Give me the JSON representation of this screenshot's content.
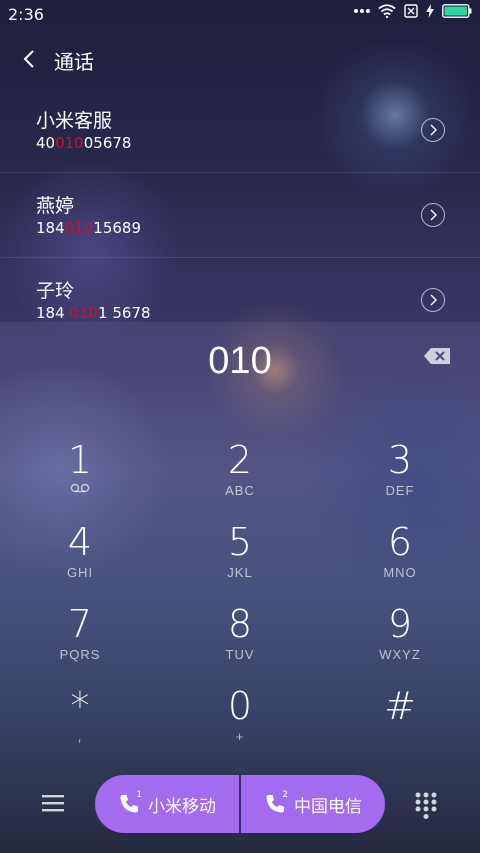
{
  "status_bar": {
    "time": "2:36",
    "icons": [
      "more-dots-icon",
      "wifi-icon",
      "no-sim-icon",
      "charging-icon",
      "battery-icon"
    ],
    "battery_color": "#2ed6a0"
  },
  "header": {
    "title": "通话"
  },
  "contacts": [
    {
      "name": "小米客服",
      "number_pre": "40",
      "number_match": "010",
      "number_post": "05678"
    },
    {
      "name": "燕婷",
      "number_pre": "184",
      "number_match": "010",
      "number_post": "15689"
    },
    {
      "name": "子玲",
      "number_pre": "184 ",
      "number_match": "010",
      "number_post": "1 5678"
    }
  ],
  "dialer": {
    "input": "010"
  },
  "keypad": [
    {
      "digit": "1",
      "letters": "",
      "sub_icon": "voicemail-icon"
    },
    {
      "digit": "2",
      "letters": "ABC"
    },
    {
      "digit": "3",
      "letters": "DEF"
    },
    {
      "digit": "4",
      "letters": "GHI"
    },
    {
      "digit": "5",
      "letters": "JKL"
    },
    {
      "digit": "6",
      "letters": "MNO"
    },
    {
      "digit": "7",
      "letters": "PQRS"
    },
    {
      "digit": "8",
      "letters": "TUV"
    },
    {
      "digit": "9",
      "letters": "WXYZ"
    },
    {
      "digit": "*",
      "letters": ","
    },
    {
      "digit": "0",
      "letters": "+"
    },
    {
      "digit": "#",
      "letters": ""
    }
  ],
  "bottom_bar": {
    "sim1_label": "小米移动",
    "sim1_num": "1",
    "sim2_label": "中国电信",
    "sim2_num": "2",
    "accent_color": "#a36bf0"
  }
}
